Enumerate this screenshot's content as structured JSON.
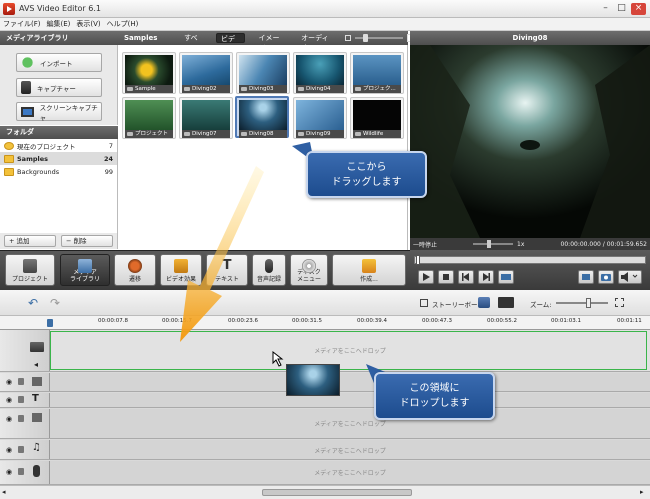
{
  "window": {
    "title": "AVS Video Editor 6.1",
    "min": "–",
    "max": "□",
    "close": "×"
  },
  "menu": [
    "ファイル(F)",
    "編集(E)",
    "表示(V)",
    "ヘルプ(H)"
  ],
  "library": {
    "header": "メディアライブラリ",
    "import": "インポート",
    "capture": "キャプチャー",
    "screen": "スクリーンキャプチャ",
    "folder_header": "フォルダ",
    "folders": [
      {
        "name": "現在のプロジェクト",
        "count": "7"
      },
      {
        "name": "Samples",
        "count": "24"
      },
      {
        "name": "Backgrounds",
        "count": "99"
      }
    ],
    "add": "追加",
    "delete": "削除"
  },
  "media": {
    "title": "Samples",
    "tabs": [
      "すべて",
      "ビデオ",
      "イメージ",
      "オーディオ"
    ],
    "thumbs": [
      "Sample",
      "Diving02",
      "Diving03",
      "Diving04",
      "プロジェク...",
      "プロジェクト",
      "Diving07",
      "Diving08",
      "Diving09",
      "Wildlife"
    ]
  },
  "preview": {
    "title": "Diving08",
    "status": "一時停止",
    "speed": "1x",
    "time": "00:00:00.000 / 00:01:59.652"
  },
  "toolbar": {
    "project": "プロジェクト",
    "media": "メディア\nライブラリ",
    "transition": "遷移",
    "effects": "ビデオ効果",
    "text": "テキスト",
    "voice": "音声記録",
    "disc": "ディスク\nメニュー",
    "create": "作成..."
  },
  "timeline": {
    "storyboard": "ストーリーボード",
    "zoom": "ズーム:",
    "ticks": [
      "00:00:07.8",
      "00:00:15.7",
      "00:00:23.6",
      "00:00:31.5",
      "00:00:39.4",
      "00:00:47.3",
      "00:00:55.2",
      "00:01:03.1",
      "00:01:11"
    ],
    "drop": "メディアをここへドロップ"
  },
  "callouts": {
    "drag": "ここから\nドラッグします",
    "drop": "この領域に\nドロップします"
  }
}
